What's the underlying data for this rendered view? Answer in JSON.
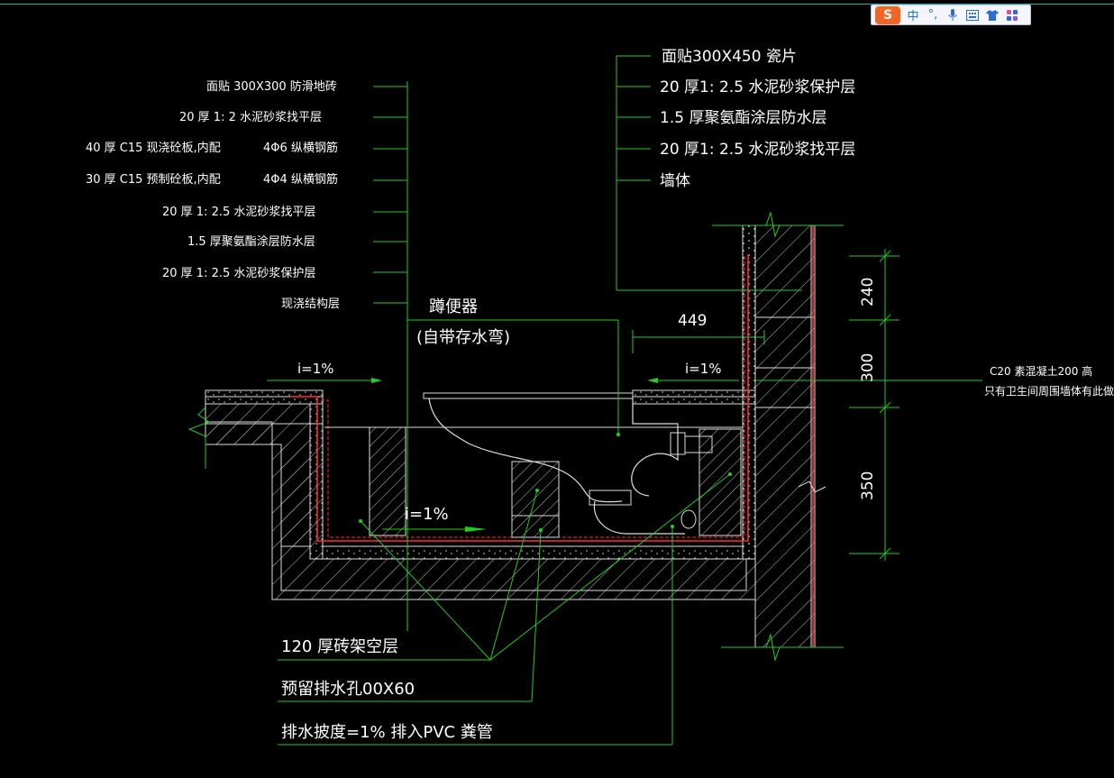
{
  "ime_toolbar": {
    "logo": "S",
    "lang": "中",
    "punct": "°,",
    "mic_icon": "microphone-icon",
    "keyboard_icon": "keyboard-icon",
    "skin_icon": "shirt-icon",
    "tools_icon": "apps-grid-icon"
  },
  "left_labels": {
    "l1": "面贴   300X300 防滑地砖",
    "l2": "20 厚 1:  2 水泥砂浆找平层",
    "l3a": "40 厚 C15  现浇砼板,内配",
    "l3b": "4Φ6 纵横钢筋",
    "l4a": "30 厚 C15  预制砼板,内配",
    "l4b": "4Φ4 纵横钢筋",
    "l5": "20 厚 1:   2.5  水泥砂浆找平层",
    "l6": "1.5   厚聚氨酯涂层防水层",
    "l7": "20 厚 1:   2.5  水泥砂浆保护层",
    "l8": "现浇结构层"
  },
  "right_labels": {
    "r1": "面贴300X450      瓷片",
    "r2": "20  厚1: 2.5  水泥砂浆保护层",
    "r3": "1.5  厚聚氨酯涂层防水层",
    "r4": "20  厚1: 2.5  水泥砂浆找平层",
    "r5": "墙体"
  },
  "toilet_label": {
    "name": "蹲便器",
    "note": "(自带存水弯)"
  },
  "dims": {
    "d449": "449",
    "d240": "240",
    "d300": "300",
    "d350": "350"
  },
  "slopes": {
    "left": "i=1%",
    "right": "i=1%",
    "bottom": "i=1%"
  },
  "side_note": {
    "line1": "C20  素混凝土200  高",
    "line2": "只有卫生间周围墙体有此做法"
  },
  "bottom_labels": {
    "b1": "120  厚砖架空层",
    "b2": "预留排水孔00X60",
    "b3": "排水披度=1%  排入PVC   粪管"
  },
  "colors": {
    "background": "#000000",
    "leader": "#22cc22",
    "outline": "#ffffff",
    "waterproof": "#ff2a2a",
    "wall_edge": "#ff2a2a",
    "ime_logo": "#f26522"
  }
}
